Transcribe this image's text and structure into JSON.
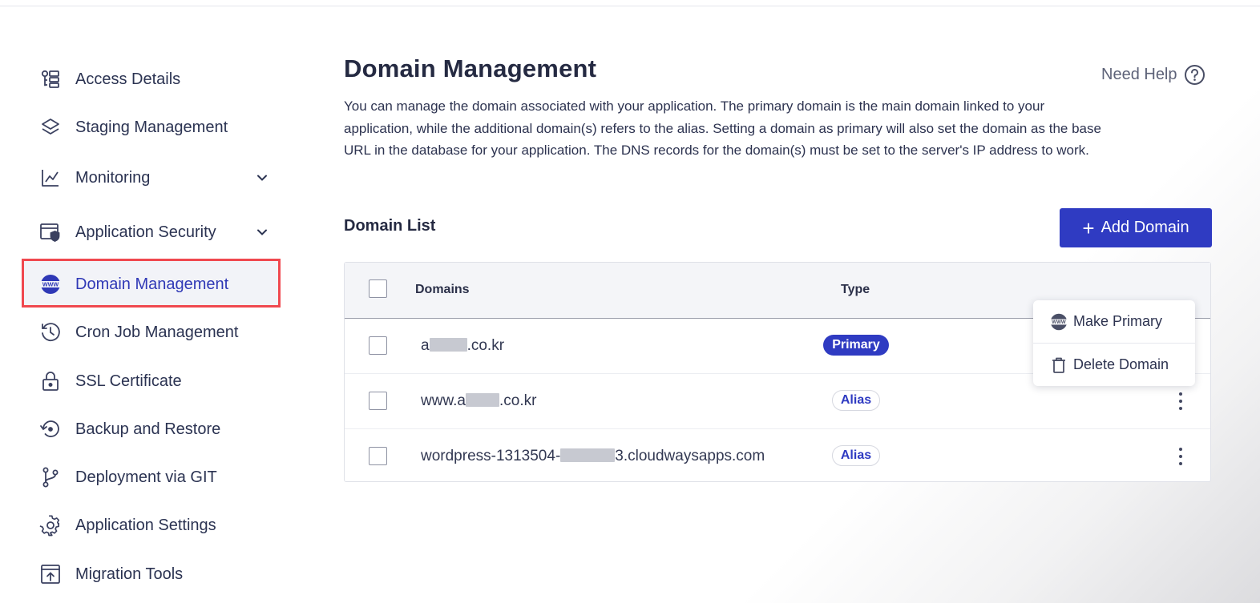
{
  "sidebar": {
    "items": [
      {
        "label": "Access Details",
        "icon": "access-details-icon"
      },
      {
        "label": "Staging Management",
        "icon": "layers-icon"
      },
      {
        "label": "Monitoring",
        "icon": "chart-line-icon",
        "expandable": true
      },
      {
        "label": "Application Security",
        "icon": "app-security-icon",
        "expandable": true
      },
      {
        "label": "Domain Management",
        "icon": "www-globe-icon",
        "active": true
      },
      {
        "label": "Cron Job Management",
        "icon": "history-clock-icon"
      },
      {
        "label": "SSL Certificate",
        "icon": "lock-icon"
      },
      {
        "label": "Backup and Restore",
        "icon": "backup-restore-icon"
      },
      {
        "label": "Deployment via GIT",
        "icon": "git-branch-icon"
      },
      {
        "label": "Application Settings",
        "icon": "gear-icon"
      },
      {
        "label": "Migration Tools",
        "icon": "upload-box-icon"
      }
    ]
  },
  "main": {
    "title": "Domain Management",
    "help_label": "Need Help",
    "description": "You can manage the domain associated with your application. The primary domain is the main domain linked to your application, while the additional domain(s) refers to the alias. Setting a domain as primary will also set the domain as the base URL in the database for your application. The DNS records for the domain(s) must be set to the server's IP address to work.",
    "list_title": "Domain List",
    "add_button_label": "Add Domain",
    "table": {
      "headers": {
        "domains": "Domains",
        "type": "Type"
      },
      "rows": [
        {
          "domain_prefix": "a",
          "domain_suffix": ".co.kr",
          "type": "Primary"
        },
        {
          "domain_prefix": "www.a",
          "domain_suffix": ".co.kr",
          "type": "Alias"
        },
        {
          "domain_prefix": "wordpress-1313504-",
          "domain_suffix": "3.cloudwaysapps.com",
          "type": "Alias"
        }
      ]
    },
    "context_menu": {
      "make_primary": "Make Primary",
      "delete_domain": "Delete Domain"
    }
  },
  "colors": {
    "accent": "#2f3bc2",
    "highlight_border": "#f0484f",
    "text": "#2b3352"
  }
}
